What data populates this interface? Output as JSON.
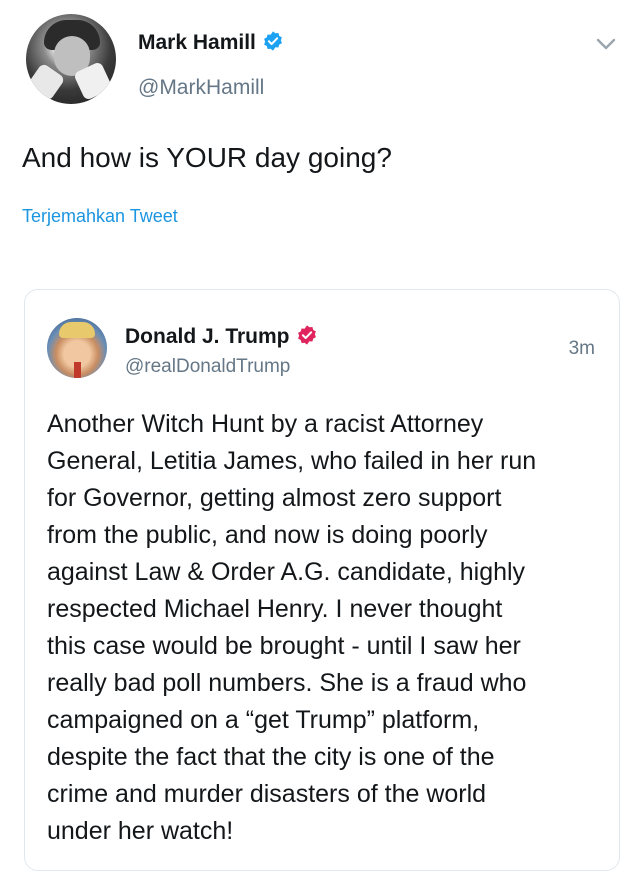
{
  "tweet": {
    "author_name": "Mark Hamill",
    "author_handle": "@MarkHamill",
    "text": "And how is YOUR day going?",
    "translate_label": "Terjemahkan Tweet"
  },
  "quoted_tweet": {
    "author_name": "Donald J. Trump",
    "author_handle": "@realDonaldTrump",
    "time": "3m",
    "text": "Another Witch Hunt by a racist Attorney\nGeneral, Letitia James, who failed in her run\nfor Governor, getting almost zero support\nfrom the public, and now is doing poorly\nagainst Law & Order A.G. candidate, highly\nrespected Michael Henry. I never thought\nthis case would be brought - until I saw her\nreally bad poll numbers. She is a fraud who\ncampaigned on a “get Trump” platform,\ndespite the fact that the city is one of the\ncrime and murder disasters of the world\nunder her watch!"
  },
  "icons": {
    "verified_blue": "verified-badge-icon",
    "verified_pink": "verified-badge-icon",
    "menu": "chevron-down-icon"
  },
  "colors": {
    "link": "#1b95e0",
    "verified_blue": "#1da1f2",
    "verified_pink": "#e0245e",
    "secondary_text": "#657786"
  }
}
